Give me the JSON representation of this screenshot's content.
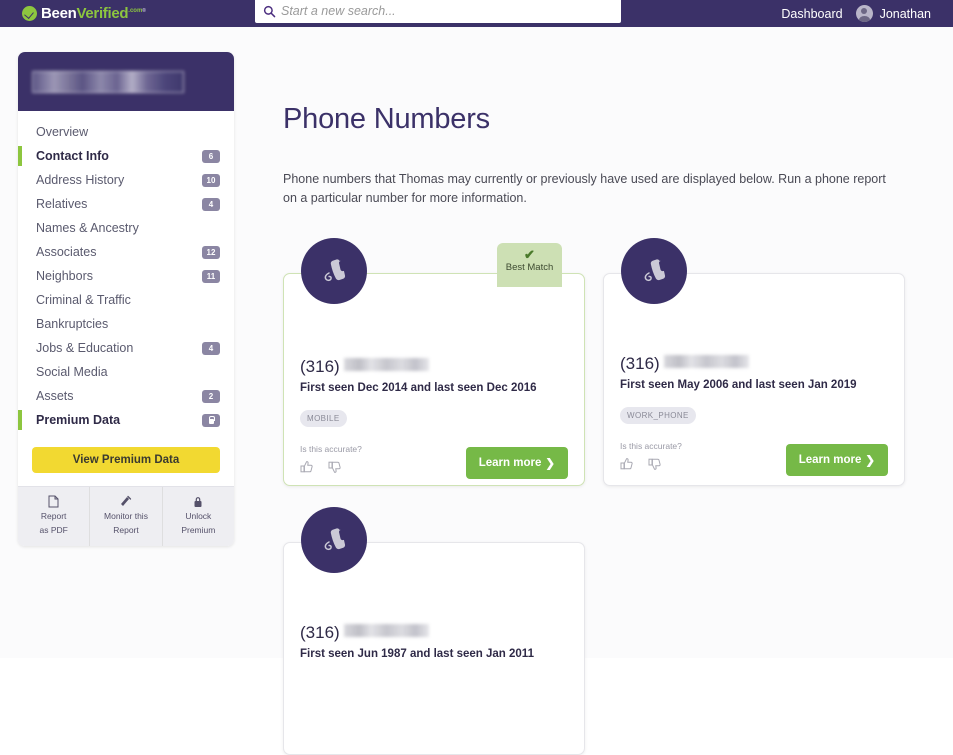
{
  "topnav": {
    "logo": {
      "been": "Been",
      "verified": "Verified",
      "dot": ".com",
      "tm": "®",
      "icon": "check-circle-icon"
    },
    "search": {
      "placeholder": "Start a new search...",
      "value": "",
      "icon": "search-icon"
    },
    "dashboard_label": "Dashboard",
    "username": "Jonathan",
    "avatar_icon": "user-avatar-icon"
  },
  "sidebar": {
    "subject_name_redacted": "",
    "items": [
      {
        "label": "Overview",
        "badge": "",
        "active": false
      },
      {
        "label": "Contact Info",
        "badge": "6",
        "active": true
      },
      {
        "label": "Address History",
        "badge": "10",
        "active": false
      },
      {
        "label": "Relatives",
        "badge": "4",
        "active": false
      },
      {
        "label": "Names & Ancestry",
        "badge": "",
        "active": false
      },
      {
        "label": "Associates",
        "badge": "12",
        "active": false
      },
      {
        "label": "Neighbors",
        "badge": "11",
        "active": false
      },
      {
        "label": "Criminal & Traffic",
        "badge": "",
        "active": false
      },
      {
        "label": "Bankruptcies",
        "badge": "",
        "active": false
      },
      {
        "label": "Jobs & Education",
        "badge": "4",
        "active": false
      },
      {
        "label": "Social Media",
        "badge": "",
        "active": false
      },
      {
        "label": "Assets",
        "badge": "2",
        "active": false
      },
      {
        "label": "Premium Data",
        "badge": "lock",
        "active": false
      }
    ],
    "premium_button": "View Premium Data",
    "actions": [
      {
        "line1": "Report",
        "line2": "as PDF",
        "icon": "pdf-document-icon"
      },
      {
        "line1": "Monitor this",
        "line2": "Report",
        "icon": "monitor-pulse-icon"
      },
      {
        "line1": "Unlock",
        "line2": "Premium",
        "icon": "lock-icon"
      }
    ]
  },
  "main": {
    "title": "Phone Numbers",
    "description": "Phone numbers that Thomas may currently or previously have used are displayed below. Run a phone report on a particular number for more information.",
    "accurate_prompt": "Is this accurate?",
    "learn_more_label": "Learn more",
    "best_match_label": "Best Match",
    "cards": [
      {
        "area_code": "(316)",
        "number_redacted": "",
        "seen": "First seen Dec 2014 and last seen Dec 2016",
        "tag": "MOBILE",
        "best_match": true
      },
      {
        "area_code": "(316)",
        "number_redacted": "",
        "seen": "First seen May 2006 and last seen Jan 2019",
        "tag": "WORK_PHONE",
        "best_match": false
      },
      {
        "area_code": "(316)",
        "number_redacted": "",
        "seen": "First seen Jun 1987 and last seen Jan 2011",
        "tag": "",
        "best_match": false
      }
    ]
  },
  "colors": {
    "brand_purple": "#3b3168",
    "brand_green": "#8dc63f",
    "button_green": "#76b947",
    "premium_yellow": "#f2d931",
    "best_match_green": "#cde0b4",
    "badge_gray": "#8b86a3"
  }
}
